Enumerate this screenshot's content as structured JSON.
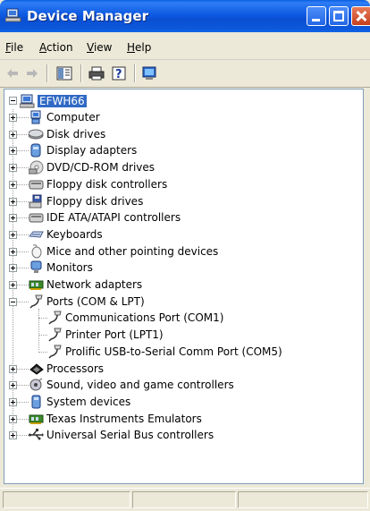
{
  "window": {
    "title": "Device Manager"
  },
  "menu": {
    "file": "File",
    "file_key": "F",
    "file_rest": "ile",
    "action": "Action",
    "action_key": "A",
    "action_rest": "ction",
    "view": "View",
    "view_key": "V",
    "view_rest": "iew",
    "help": "Help",
    "help_key": "H",
    "help_rest": "elp"
  },
  "toolbar": {
    "icons": [
      "back-arrow-icon",
      "forward-arrow-icon",
      "properties-icon",
      "print-icon",
      "help-icon",
      "scan-hardware-icon"
    ]
  },
  "tree": {
    "root": "EFWH66",
    "items": [
      {
        "label": "Computer",
        "icon": "computer-icon"
      },
      {
        "label": "Disk drives",
        "icon": "disk-drive-icon"
      },
      {
        "label": "Display adapters",
        "icon": "display-adapter-icon"
      },
      {
        "label": "DVD/CD-ROM drives",
        "icon": "cdrom-icon"
      },
      {
        "label": "Floppy disk controllers",
        "icon": "floppy-controller-icon"
      },
      {
        "label": "Floppy disk drives",
        "icon": "floppy-drive-icon"
      },
      {
        "label": "IDE ATA/ATAPI controllers",
        "icon": "ide-controller-icon"
      },
      {
        "label": "Keyboards",
        "icon": "keyboard-icon"
      },
      {
        "label": "Mice and other pointing devices",
        "icon": "mouse-icon"
      },
      {
        "label": "Monitors",
        "icon": "monitor-icon"
      },
      {
        "label": "Network adapters",
        "icon": "network-adapter-icon"
      },
      {
        "label": "Ports (COM & LPT)",
        "icon": "port-icon",
        "expanded": true,
        "children": [
          {
            "label": "Communications Port (COM1)",
            "icon": "port-icon"
          },
          {
            "label": "Printer Port (LPT1)",
            "icon": "port-icon"
          },
          {
            "label": "Prolific USB-to-Serial Comm Port (COM5)",
            "icon": "port-icon"
          }
        ]
      },
      {
        "label": "Processors",
        "icon": "processor-icon"
      },
      {
        "label": "Sound, video and game controllers",
        "icon": "sound-icon"
      },
      {
        "label": "System devices",
        "icon": "system-device-icon"
      },
      {
        "label": "Texas Instruments Emulators",
        "icon": "emulator-icon"
      },
      {
        "label": "Universal Serial Bus controllers",
        "icon": "usb-icon"
      }
    ]
  },
  "colors": {
    "titlebar": "#0a4fd2",
    "selection": "#316ac5",
    "chrome": "#ece9d8"
  }
}
